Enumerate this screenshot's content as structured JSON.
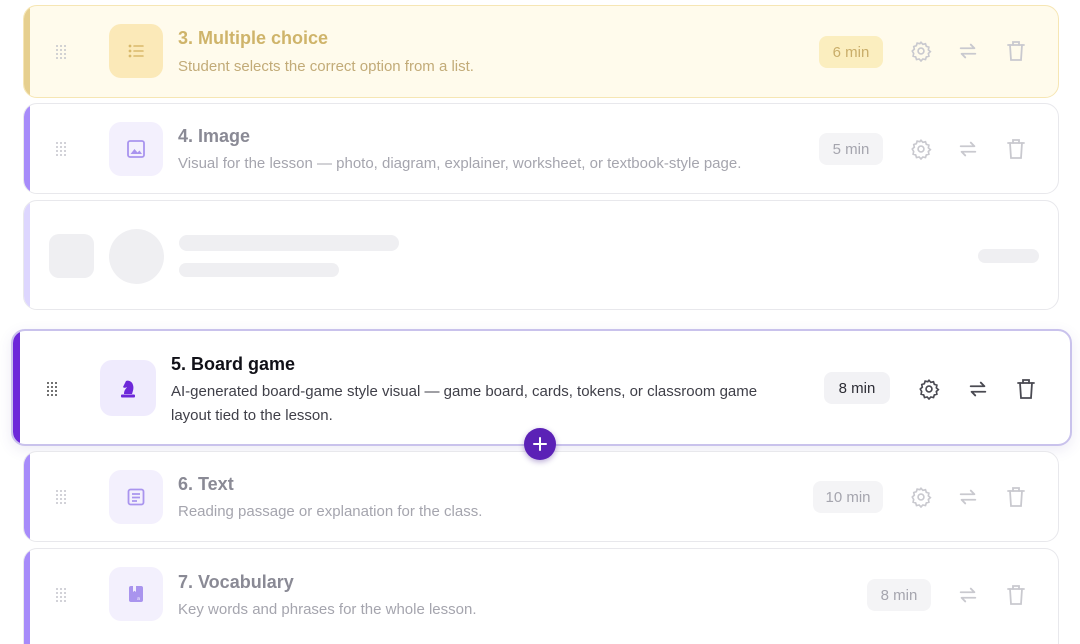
{
  "colors": {
    "yellow_accent": "#f0d68c",
    "purple_accent": "#a78bfa",
    "active_accent": "#6d28d9",
    "add_button": "#5b21b6"
  },
  "activities": [
    {
      "title": "3. Multiple choice",
      "description": "Student selects the correct option from a list.",
      "duration": "6 min",
      "icon": "list-icon"
    },
    {
      "title": "4. Image",
      "description": "Visual for the lesson — photo, diagram, explainer, worksheet, or textbook-style page.",
      "duration": "5 min",
      "icon": "image-icon"
    },
    {
      "title": "5. Board game",
      "description_line1": "AI-generated board-game style visual — game board, cards, tokens, or classroom game",
      "description_line2": "layout tied to the lesson.",
      "duration": "8 min",
      "icon": "chess-knight-icon"
    },
    {
      "title": "6. Text",
      "description": "Reading passage or explanation for the class.",
      "duration": "10 min",
      "icon": "document-icon"
    },
    {
      "title": "7. Vocabulary",
      "description": "Key words and phrases for the whole lesson.",
      "duration": "8 min",
      "icon": "vocabulary-book-icon"
    }
  ],
  "actions": {
    "settings_icon": "gear-icon",
    "swap_icon": "swap-arrows-icon",
    "delete_icon": "trash-icon",
    "add_icon": "plus-icon"
  }
}
